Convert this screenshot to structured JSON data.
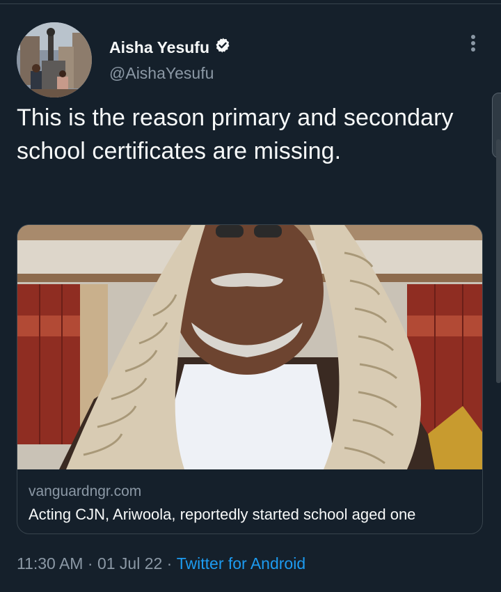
{
  "user": {
    "display_name": "Aisha Yesufu",
    "handle": "@AishaYesufu",
    "verified": true
  },
  "tweet": {
    "text": "This is the reason primary and secondary school certificates are missing."
  },
  "card": {
    "domain": "vanguardngr.com",
    "title": "Acting CJN, Ariwoola, reportedly started school aged one"
  },
  "meta": {
    "time": "11:30 AM",
    "separator1": " · ",
    "date": "01 Jul 22",
    "separator2": " · ",
    "source": "Twitter for Android"
  },
  "colors": {
    "background": "#15202b",
    "text_primary": "#f7f9f9",
    "text_secondary": "#8b98a5",
    "accent": "#1d9bf0",
    "border": "#38444d"
  },
  "icons": {
    "verified": "verified-badge-icon",
    "more": "more-vertical-icon"
  }
}
